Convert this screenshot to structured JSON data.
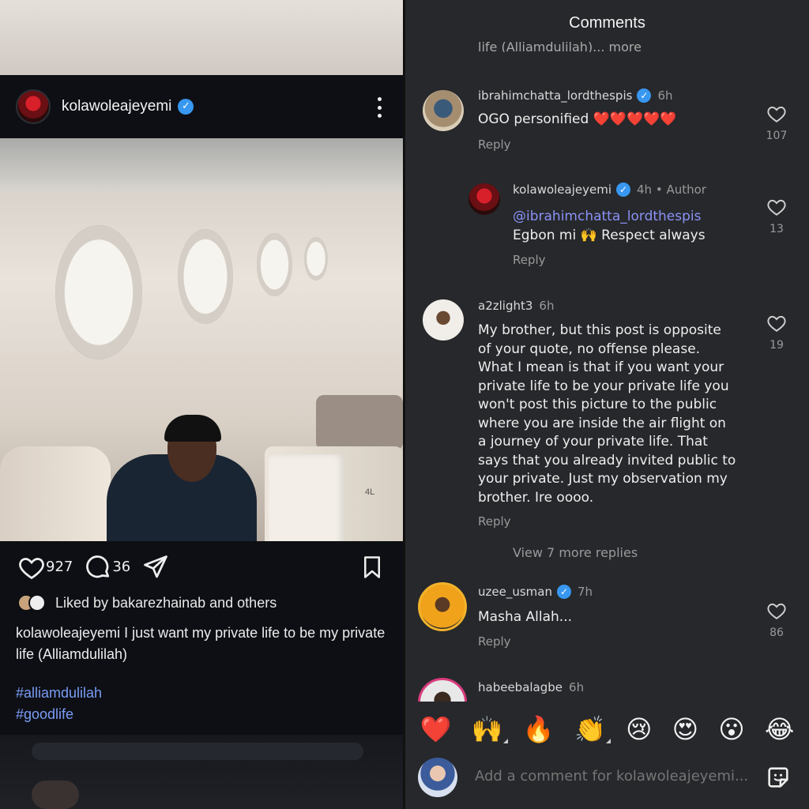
{
  "post": {
    "username": "kolawoleajeyemi",
    "verified_mark": "✓",
    "likes": "927",
    "comments": "36",
    "liked_by": "Liked by bakarezhainab and others",
    "caption_user": "kolawoleajeyemi",
    "caption_text": " I just want my private life to be my private life (Alliamdulilah)",
    "hashtags": [
      "#alliamdulilah",
      "#goodlife"
    ],
    "photo_seat_label": "4L"
  },
  "comments_sheet": {
    "title": "Comments",
    "cut_off_text": "life (Alliamdulilah)... more",
    "comments": [
      {
        "username": "ibrahimchatta_lordthespis",
        "verified": true,
        "time": "6h",
        "text": "OGO personified ❤️❤️❤️❤️❤️",
        "reply": "Reply",
        "likes": "107"
      },
      {
        "username": "kolawoleajeyemi",
        "verified": true,
        "time": "4h • Author",
        "mention": "@ibrahimchatta_lordthespis",
        "text": "Egbon mi 🙌 Respect always",
        "reply": "Reply",
        "likes": "13"
      },
      {
        "username": "a2zlight3",
        "verified": false,
        "time": "6h",
        "text_lines": [
          "My brother, but this post is opposite",
          "of your quote, no offense please.",
          "What I mean is that if you want your",
          "private life to be your private life you",
          "won't post this picture to the public",
          "where you are inside the air flight on",
          "a journey of your private life. That",
          "says that you already invited public to",
          "your private. Just my observation my",
          "brother. Ire oooo."
        ],
        "reply": "Reply",
        "likes": "19"
      },
      {
        "username": "uzee_usman",
        "verified": true,
        "time": "7h",
        "text": "Masha Allah...",
        "reply": "Reply",
        "likes": "86"
      },
      {
        "username": "habeebalagbe",
        "verified": false,
        "time": "6h"
      }
    ],
    "view_more": "View 7 more replies",
    "quick_emojis": [
      "❤️",
      "🙌",
      "🔥",
      "👏",
      "😢",
      "😍",
      "😮",
      "😂"
    ],
    "add_comment_placeholder": "Add a comment for kolawoleajeyemi..."
  },
  "colors": {
    "verified_blue": "#3897f0",
    "mention": "#8b92f6",
    "hashtag": "#7a9cf5",
    "sheet_bg": "#26282b",
    "post_bg": "#0d0f14"
  },
  "icons": {
    "like": "heart-icon",
    "comment": "comment-bubble-icon",
    "share": "paper-plane-icon",
    "save": "bookmark-icon",
    "more": "more-vertical-icon",
    "sticker": "sticker-icon"
  }
}
